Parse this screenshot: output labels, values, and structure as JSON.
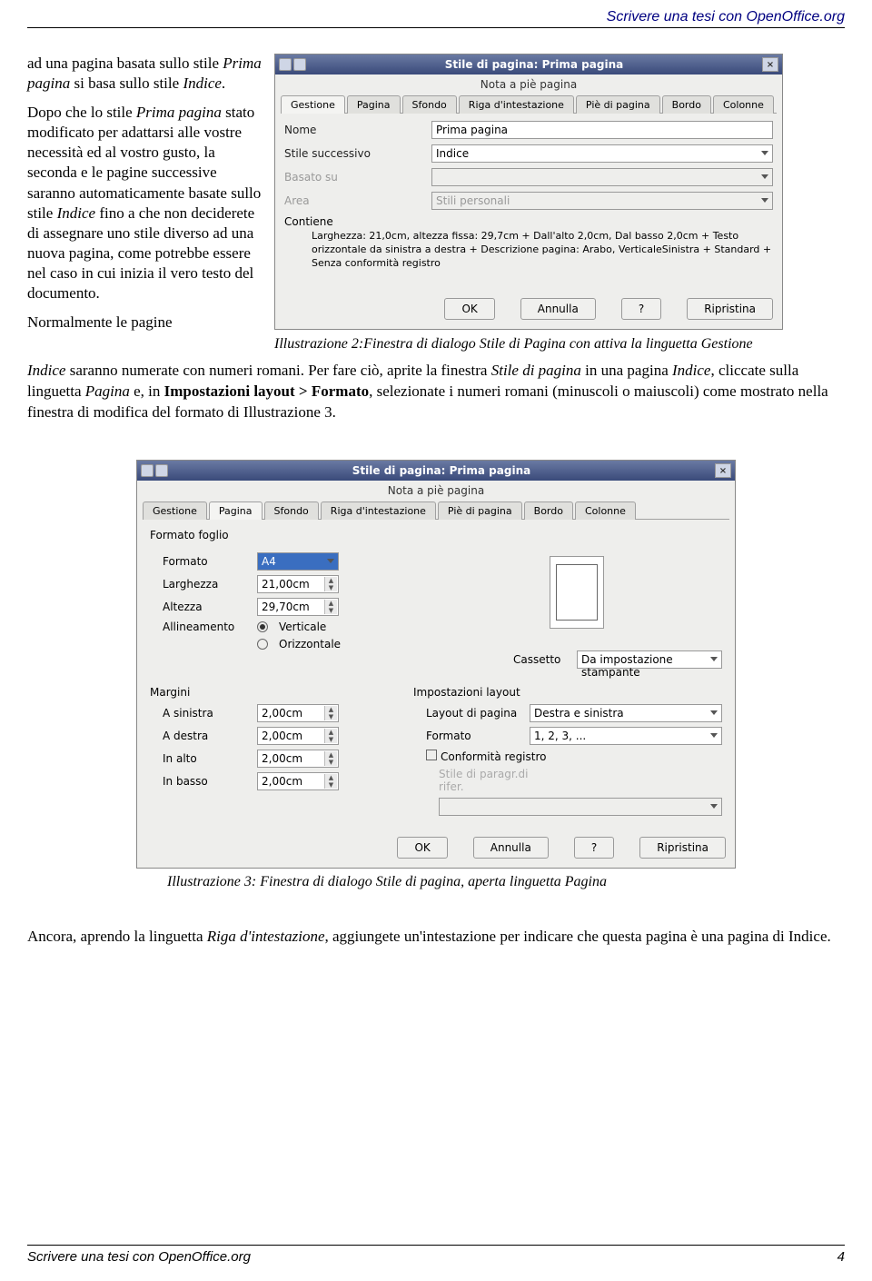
{
  "header": "Scrivere una tesi con OpenOffice.org",
  "left": {
    "p1a": "ad una pagina basata sullo stile ",
    "p1b": "Prima pagina",
    "p1c": " si basa sullo stile ",
    "p1d": "Indice",
    "p1e": ".",
    "p2a": "Dopo che lo stile ",
    "p2b": "Prima pagina",
    "p2c": "  stato modificato per adattarsi alle vostre necessità ed al vostro gusto, la seconda e le pagine successive saranno automaticamente basate sullo stile ",
    "p2d": "Indice",
    "p2e": " fino a che non deciderete di assegnare uno stile diverso ad una nuova pagina, come potrebbe essere nel caso in cui inizia il vero testo del documento.",
    "p3": "Normalmente le pagine "
  },
  "dlg1": {
    "title": "Stile di pagina: Prima pagina",
    "toplabel": "Nota a piè pagina",
    "tabs": [
      "Gestione",
      "Pagina",
      "Sfondo",
      "Riga d'intestazione",
      "Piè di pagina",
      "Bordo",
      "Colonne"
    ],
    "active_tab": 0,
    "name_label": "Nome",
    "name_value": "Prima pagina",
    "next_label": "Stile successivo",
    "next_value": "Indice",
    "based_label": "Basato su",
    "based_value": "",
    "area_label": "Area",
    "area_value": "Stili personali",
    "contiene_label": "Contiene",
    "contiene_text": "Larghezza: 21,0cm, altezza fissa: 29,7cm + Dall'alto  2,0cm, Dal basso  2,0cm + Testo orizzontale da sinistra a destra + Descrizione pagina:  Arabo, VerticaleSinistra + Standard + Senza conformità registro",
    "ok": "OK",
    "cancel": "Annulla",
    "help": "?",
    "reset": "Ripristina"
  },
  "caption1": "Illustrazione 2:Finestra di dialogo Stile di Pagina con attiva la linguetta Gestione",
  "body": {
    "t1": "Indice",
    "t2": " saranno numerate con numeri romani. Per fare ciò, aprite la finestra ",
    "t3": "Stile di pagina",
    "t4": " in una pagina ",
    "t5": "Indice",
    "t6": ", cliccate sulla linguetta ",
    "t7": "Pagina",
    "t8": " e, in ",
    "t9": "Impostazioni layout > Formato",
    "t10": ", selezionate i numeri romani (minuscoli o maiuscoli) come mostrato nella finestra di modifica del formato di Illustrazione 3."
  },
  "dlg2": {
    "title": "Stile di pagina: Prima pagina",
    "toplabel": "Nota a piè pagina",
    "tabs": [
      "Gestione",
      "Pagina",
      "Sfondo",
      "Riga d'intestazione",
      "Piè di pagina",
      "Bordo",
      "Colonne"
    ],
    "active_tab": 1,
    "grp_formato": "Formato foglio",
    "formato_label": "Formato",
    "formato_value": "A4",
    "largh_label": "Larghezza",
    "largh_value": "21,00cm",
    "alt_label": "Altezza",
    "alt_value": "29,70cm",
    "allin_label": "Allineamento",
    "vert": "Verticale",
    "oriz": "Orizzontale",
    "cassetto_label": "Cassetto",
    "cassetto_value": "Da impostazione stampante",
    "grp_margini": "Margini",
    "m_sx_label": "A sinistra",
    "m_sx": "2,00cm",
    "m_dx_label": "A destra",
    "m_dx": "2,00cm",
    "m_up_label": "In alto",
    "m_up": "2,00cm",
    "m_dn_label": "In basso",
    "m_dn": "2,00cm",
    "grp_layout": "Impostazioni layout",
    "layout_lab": "Layout di pagina",
    "layout_val": "Destra e sinistra",
    "fmt_lab": "Formato",
    "fmt_val": "1, 2, 3, ...",
    "conf_lab": "Conformità registro",
    "rifer_lab": "Stile di paragr.di rifer.",
    "ok": "OK",
    "cancel": "Annulla",
    "help": "?",
    "reset": "Ripristina"
  },
  "caption2": "Illustrazione 3: Finestra di dialogo Stile di pagina, aperta linguetta Pagina",
  "bottom": {
    "a": "Ancora, aprendo la linguetta ",
    "b": "Riga d'intestazione",
    "c": ", aggiungete un'intestazione per indicare che questa pagina è una pagina di Indice."
  },
  "footer": {
    "left": "Scrivere una tesi con OpenOffice.org",
    "right": "4"
  }
}
